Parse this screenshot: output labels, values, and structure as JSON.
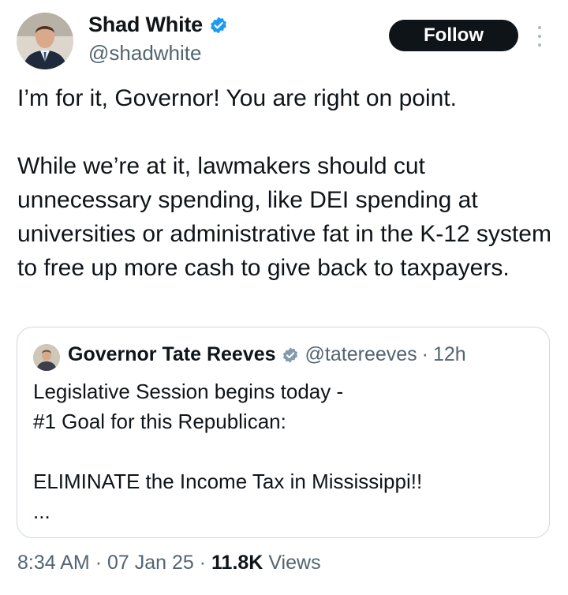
{
  "author": {
    "name": "Shad White",
    "handle": "@shadwhite",
    "verified": true
  },
  "actions": {
    "follow_label": "Follow",
    "more_icon": "more-vertical-icon"
  },
  "tweet": {
    "paragraph_1": "I’m for it, Governor! You are right on point.",
    "paragraph_2": "While we’re at it, lawmakers should cut unnecessary spending, like DEI spending  at universities or administrative fat in the K-12 system to free up more cash to give back to taxpayers."
  },
  "quoted_tweet": {
    "name": "Governor Tate Reeves",
    "handle": "@tatereeves",
    "separator": "·",
    "time": "12h",
    "verified": true,
    "line_1": "Legislative Session begins today -",
    "line_2": "#1 Goal for this Republican:",
    "line_3": "ELIMINATE the Income Tax in Mississippi!!",
    "truncation": "..."
  },
  "meta": {
    "time": "8:34 AM",
    "separator": "·",
    "date": "07 Jan 25",
    "views_count": "11.8K",
    "views_label": "Views"
  },
  "colors": {
    "text": "#0f1419",
    "secondary": "#536471",
    "verified_blue": "#1d9bf0",
    "border": "#cfd9de",
    "follow_bg": "#0f1419"
  }
}
